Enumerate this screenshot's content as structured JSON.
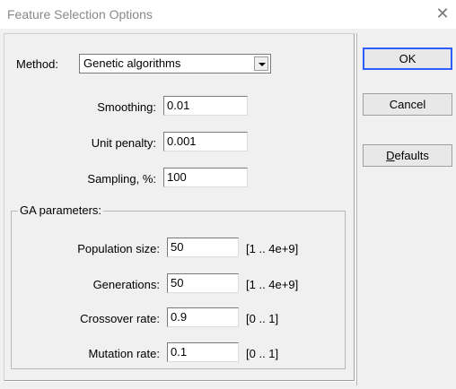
{
  "window": {
    "title": "Feature Selection Options"
  },
  "method": {
    "label": "Method:",
    "value": "Genetic algorithms"
  },
  "fields": {
    "smoothing": {
      "label": "Smoothing:",
      "value": "0.01"
    },
    "unit_penalty": {
      "label": "Unit penalty:",
      "value": "0.001"
    },
    "sampling": {
      "label": "Sampling, %:",
      "value": "100"
    }
  },
  "ga": {
    "title": "GA parameters:",
    "population": {
      "label": "Population size:",
      "value": "50",
      "range": "[1 .. 4e+9]"
    },
    "generations": {
      "label": "Generations:",
      "value": "50",
      "range": "[1 .. 4e+9]"
    },
    "crossover": {
      "label": "Crossover rate:",
      "value": "0.9",
      "range": "[0 .. 1]"
    },
    "mutation": {
      "label": "Mutation rate:",
      "value": "0.1",
      "range": "[0 .. 1]"
    }
  },
  "buttons": {
    "ok": "OK",
    "cancel": "Cancel",
    "defaults_first": "D",
    "defaults_rest": "efaults"
  },
  "colors": {
    "accent": "#2e5cff",
    "panel": "#f0f0f0"
  }
}
